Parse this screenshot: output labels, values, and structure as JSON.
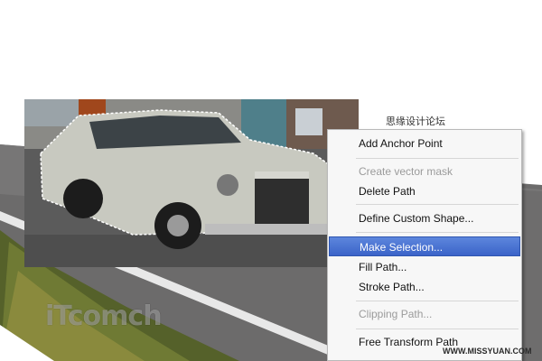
{
  "watermarks": {
    "top_right": "思缘设计论坛",
    "bottom_right": "WWW.MISSYUAN.COM",
    "logo_text": "iTcomch"
  },
  "context_menu": {
    "items": [
      {
        "label": "Add Anchor Point",
        "state": "enabled"
      },
      {
        "label": "Create vector mask",
        "state": "disabled"
      },
      {
        "label": "Delete Path",
        "state": "enabled"
      },
      {
        "label": "Define Custom Shape...",
        "state": "enabled"
      },
      {
        "label": "Make Selection...",
        "state": "highlighted"
      },
      {
        "label": "Fill Path...",
        "state": "enabled"
      },
      {
        "label": "Stroke Path...",
        "state": "enabled"
      },
      {
        "label": "Clipping Path...",
        "state": "disabled"
      },
      {
        "label": "Free Transform Path",
        "state": "enabled"
      }
    ]
  },
  "colors": {
    "menu_highlight": "#3b64c9",
    "menu_background": "#f7f7f7",
    "disabled_text": "#9b9b9b"
  }
}
